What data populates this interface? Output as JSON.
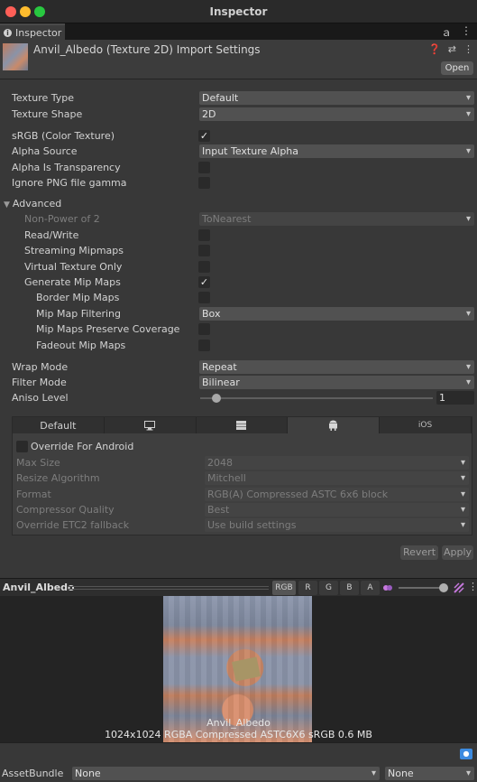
{
  "window": {
    "title": "Inspector"
  },
  "tab": {
    "label": "Inspector"
  },
  "header": {
    "title": "Anvil_Albedo (Texture 2D) Import Settings",
    "open_label": "Open"
  },
  "settings": {
    "texture_type": {
      "label": "Texture Type",
      "value": "Default"
    },
    "texture_shape": {
      "label": "Texture Shape",
      "value": "2D"
    },
    "srgb": {
      "label": "sRGB (Color Texture)",
      "checked": true
    },
    "alpha_source": {
      "label": "Alpha Source",
      "value": "Input Texture Alpha"
    },
    "alpha_is_transparency": {
      "label": "Alpha Is Transparency",
      "checked": false
    },
    "ignore_png_gamma": {
      "label": "Ignore PNG file gamma",
      "checked": false
    },
    "advanced": {
      "label": "Advanced"
    },
    "non_power_of_2": {
      "label": "Non-Power of 2",
      "value": "ToNearest"
    },
    "read_write": {
      "label": "Read/Write",
      "checked": false
    },
    "streaming_mipmaps": {
      "label": "Streaming Mipmaps",
      "checked": false
    },
    "virtual_texture_only": {
      "label": "Virtual Texture Only",
      "checked": false
    },
    "generate_mip_maps": {
      "label": "Generate Mip Maps",
      "checked": true
    },
    "border_mip_maps": {
      "label": "Border Mip Maps",
      "checked": false
    },
    "mip_map_filtering": {
      "label": "Mip Map Filtering",
      "value": "Box"
    },
    "mip_maps_preserve_coverage": {
      "label": "Mip Maps Preserve Coverage",
      "checked": false
    },
    "fadeout_mip_maps": {
      "label": "Fadeout Mip Maps",
      "checked": false
    },
    "wrap_mode": {
      "label": "Wrap Mode",
      "value": "Repeat"
    },
    "filter_mode": {
      "label": "Filter Mode",
      "value": "Bilinear"
    },
    "aniso_level": {
      "label": "Aniso Level",
      "value": "1",
      "level": 1,
      "max": 16
    }
  },
  "platform": {
    "tabs": [
      "Default",
      "",
      "",
      "",
      "iOS"
    ],
    "override": {
      "label": "Override For Android",
      "checked": false
    },
    "max_size": {
      "label": "Max Size",
      "value": "2048"
    },
    "resize_algorithm": {
      "label": "Resize Algorithm",
      "value": "Mitchell"
    },
    "format": {
      "label": "Format",
      "value": "RGB(A) Compressed ASTC 6x6 block"
    },
    "compressor_quality": {
      "label": "Compressor Quality",
      "value": "Best"
    },
    "override_etc2": {
      "label": "Override ETC2 fallback",
      "value": "Use build settings"
    }
  },
  "actions": {
    "revert": "Revert",
    "apply": "Apply"
  },
  "preview": {
    "title": "Anvil_Albedo",
    "channels": [
      "RGB",
      "R",
      "G",
      "B",
      "A"
    ],
    "name": "Anvil_Albedo",
    "info": "1024x1024  RGBA Compressed ASTC6X6 sRGB  0.6 MB"
  },
  "assetbundle": {
    "label": "AssetBundle",
    "value": "None",
    "variant": "None"
  },
  "colors": {
    "panel": "#383838",
    "accent_tag": "#3d8be0",
    "mipmap_icon": "#c678dd"
  }
}
